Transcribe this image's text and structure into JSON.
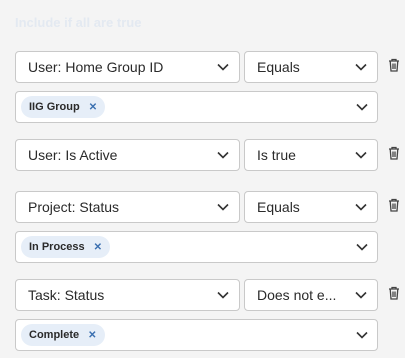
{
  "header": {
    "label": "Include if all are true"
  },
  "conditions": [
    {
      "field": "User: Home Group ID",
      "operator": "Equals",
      "values": [
        "IIG Group"
      ]
    },
    {
      "field": "User: Is Active",
      "operator": "Is true",
      "values": []
    },
    {
      "field": "Project: Status",
      "operator": "Equals",
      "values": [
        "In Process"
      ]
    },
    {
      "field": "Task: Status",
      "operator": "Does not e...",
      "values": [
        "Complete"
      ]
    }
  ],
  "icons": {
    "dropdown": "chevron-down-icon",
    "remove_chip": "close-icon",
    "delete": "trash-icon"
  },
  "colors": {
    "chip_bg": "#e6eef8",
    "chip_x": "#3a6fb0",
    "border": "#c9c9c9",
    "background": "#f4f4f4"
  }
}
